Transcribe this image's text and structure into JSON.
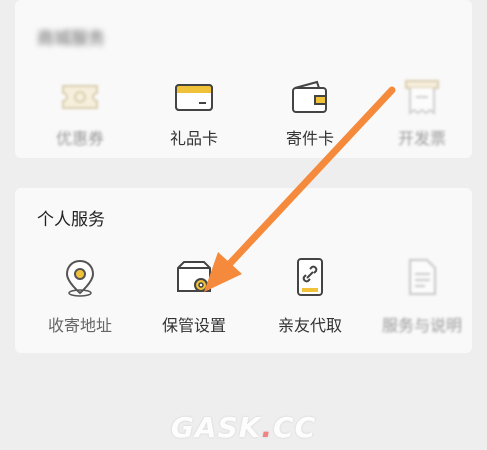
{
  "top_section": {
    "title": "商城服务",
    "items": [
      {
        "label": "优惠券",
        "icon": "coupon-icon"
      },
      {
        "label": "礼品卡",
        "icon": "gift-card-icon"
      },
      {
        "label": "寄件卡",
        "icon": "wallet-card-icon"
      },
      {
        "label": "开发票",
        "icon": "invoice-icon"
      }
    ]
  },
  "personal_section": {
    "title": "个人服务",
    "items": [
      {
        "label": "收寄地址",
        "icon": "location-pin-icon"
      },
      {
        "label": "保管设置",
        "icon": "storage-settings-icon"
      },
      {
        "label": "亲友代取",
        "icon": "link-phone-icon"
      },
      {
        "label": "服务与说明",
        "icon": "document-icon"
      }
    ]
  },
  "annotation": {
    "arrow_color": "#f58a3c"
  },
  "watermark": {
    "text_a": "GASK",
    "text_dot": ".",
    "text_b": "CC"
  },
  "colors": {
    "accent": "#f0c23a",
    "icon_stroke": "#555555"
  }
}
